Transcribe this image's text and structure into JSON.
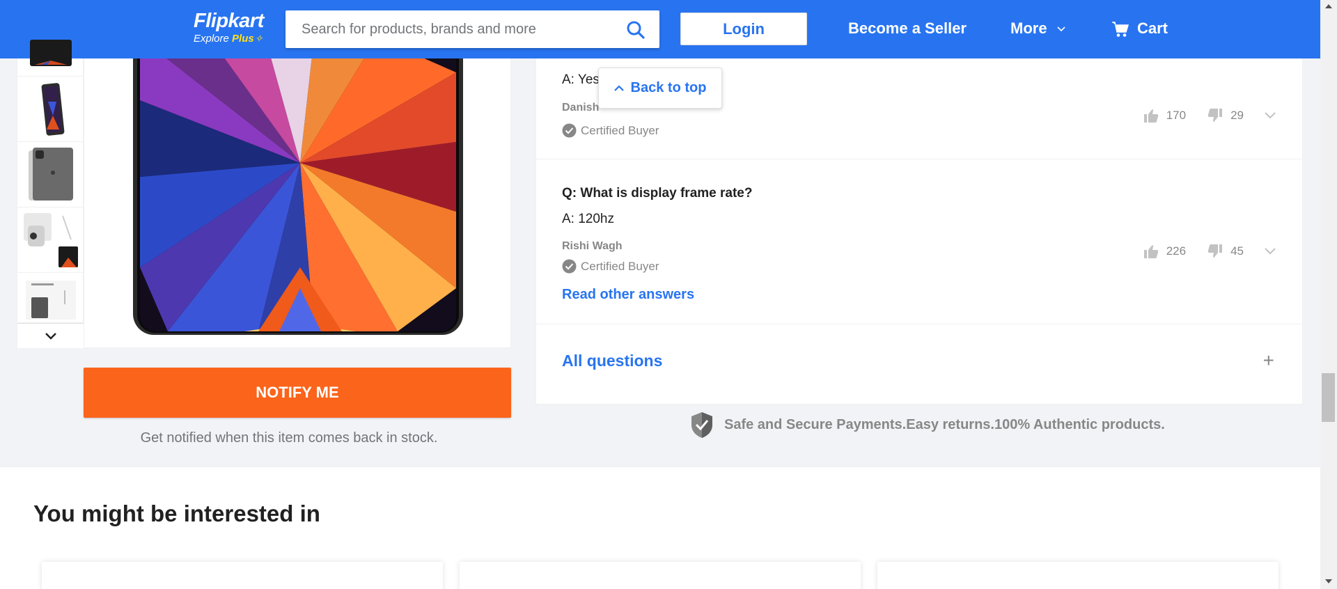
{
  "header": {
    "logo_text": "Flipkart",
    "logo_sub": "Explore",
    "logo_plus": "Plus",
    "search_placeholder": "Search for products, brands and more",
    "login_label": "Login",
    "seller_label": "Become a Seller",
    "more_label": "More",
    "cart_label": "Cart",
    "brand_color": "#2874f0"
  },
  "product": {
    "thumbnails": [
      "tablet-front-thumb",
      "tablet-angle-thumb",
      "tablet-back-thumb",
      "tablet-camera-thumb",
      "box-contents-thumb"
    ],
    "notify_label": "NOTIFY ME",
    "notify_note": "Get notified when this item comes back in stock."
  },
  "qa": {
    "back_to_top": "Back to top",
    "items": [
      {
        "answer": "A: Yes",
        "author": "Danish",
        "certified": "Certified Buyer",
        "upvotes": "170",
        "downvotes": "29"
      },
      {
        "question": "Q: What is display frame rate?",
        "answer": "A: 120hz",
        "author": "Rishi Wagh",
        "certified": "Certified Buyer",
        "upvotes": "226",
        "downvotes": "45",
        "read_other": "Read other answers"
      }
    ],
    "all_questions": "All questions",
    "expand_symbol": "+"
  },
  "secure_text": "Safe and Secure Payments.Easy returns.100% Authentic products.",
  "recommendations": {
    "title": "You might be interested in"
  },
  "colors": {
    "notify_button": "#fb641b",
    "link": "#2874f0"
  }
}
